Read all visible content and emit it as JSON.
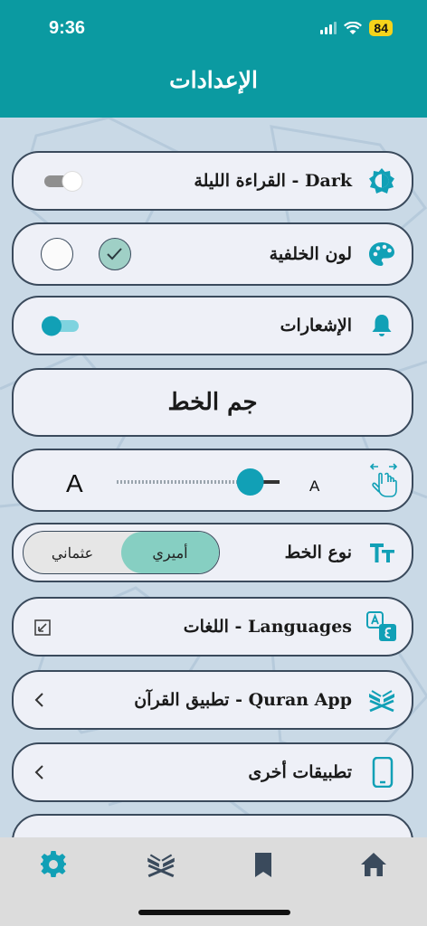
{
  "status_bar": {
    "time": "9:36",
    "battery": "84"
  },
  "header": {
    "title": "الإعدادات"
  },
  "settings": {
    "night_mode": {
      "label": "القراءة الليلة - Dark"
    },
    "background_color": {
      "label": "لون الخلفية"
    },
    "notifications": {
      "label": "الإشعارات"
    },
    "font_size_header": {
      "label": "جم الخط"
    },
    "font_size_slider": {
      "large_label": "A",
      "small_label": "A",
      "level": 0.82
    },
    "font_type": {
      "label": "نوع الخط",
      "options": [
        "عثماني",
        "أميري"
      ],
      "selected": "أميري"
    },
    "languages": {
      "label": "اللغات - Languages"
    },
    "quran_app": {
      "label": "تطبيق القرآن - Quran App"
    },
    "other_apps": {
      "label": "تطبيقات أخرى"
    }
  },
  "colors": {
    "accent": "#0b9aa1",
    "teal_icon": "#11a0b6",
    "row_bg": "#eef0f7",
    "selected": "#86cfc2",
    "page_bg": "#c9d9e6"
  },
  "icons": {
    "night_mode": "contrast-icon",
    "background_color": "palette-icon",
    "notifications": "bell-icon",
    "font_size": "pinch-zoom-icon",
    "font_type": "text-size-icon",
    "languages": "translate-icon",
    "quran_app": "quran-stand-icon",
    "other_apps": "phone-icon",
    "nav": [
      "gear-icon",
      "quran-stand-icon",
      "bookmark-icon",
      "home-icon"
    ]
  }
}
